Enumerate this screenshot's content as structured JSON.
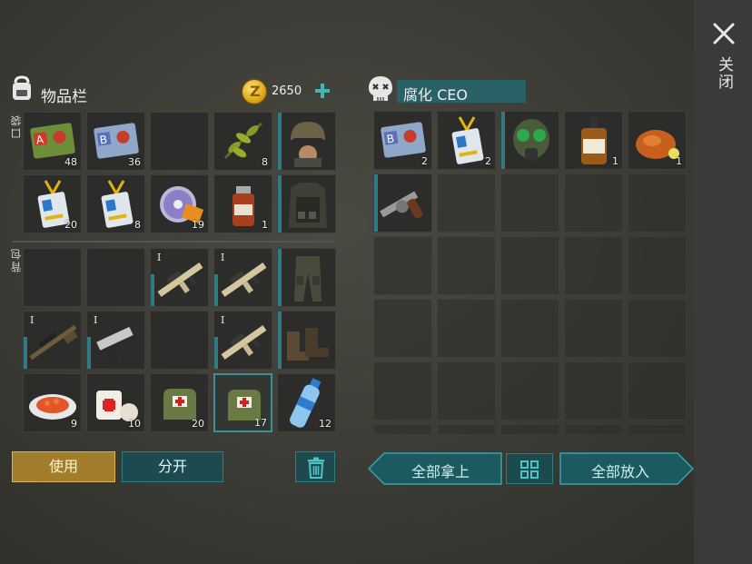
{
  "close": {
    "label": "关闭"
  },
  "inventory": {
    "title": "物品栏",
    "money": "2650",
    "pocket_label": "口袋",
    "backpack_label": "背包",
    "pocket_slots": [
      {
        "item": "keycard-a-icon",
        "count": "48"
      },
      {
        "item": "keycard-b-icon",
        "count": "36"
      },
      {
        "item": "empty-slot",
        "count": ""
      },
      {
        "item": "herb-plant-icon",
        "count": "8"
      },
      {
        "item": "helmet-icon",
        "count": "",
        "equip": true
      },
      {
        "item": "id-badge-icon",
        "count": "20"
      },
      {
        "item": "id-badge-icon",
        "count": "8"
      },
      {
        "item": "cd-disc-icon",
        "count": "19"
      },
      {
        "item": "medicine-bottle-icon",
        "count": "1"
      },
      {
        "item": "body-armor-icon",
        "count": "",
        "equip": true
      }
    ],
    "backpack_slots": [
      {
        "item": "empty-slot",
        "count": ""
      },
      {
        "item": "empty-slot",
        "count": ""
      },
      {
        "item": "assault-rifle-icon",
        "count": "",
        "tier": "I"
      },
      {
        "item": "assault-rifle-icon",
        "count": "",
        "tier": "I"
      },
      {
        "item": "tactical-pants-icon",
        "count": "",
        "equip": true
      },
      {
        "item": "sniper-rifle-icon",
        "count": "",
        "tier": "I"
      },
      {
        "item": "desert-eagle-pistol-icon",
        "count": "",
        "tier": "I"
      },
      {
        "item": "empty-slot",
        "count": ""
      },
      {
        "item": "assault-rifle-icon",
        "count": "",
        "tier": "I"
      },
      {
        "item": "boots-icon",
        "count": "",
        "equip": true
      },
      {
        "item": "food-plate-icon",
        "count": "9"
      },
      {
        "item": "bandage-icon",
        "count": "10"
      },
      {
        "item": "medkit-bag-icon",
        "count": "20"
      },
      {
        "item": "medkit-bag-icon",
        "count": "17",
        "selected": true
      },
      {
        "item": "water-bottle-icon",
        "count": "12"
      }
    ],
    "buttons": {
      "use": "使用",
      "split": "分开"
    }
  },
  "loot": {
    "name": "腐化 CEO",
    "slots": [
      {
        "item": "keycard-b-icon",
        "count": "2"
      },
      {
        "item": "id-badge-icon",
        "count": "2"
      },
      {
        "item": "gas-mask-icon",
        "count": ""
      },
      {
        "item": "whiskey-bottle-icon",
        "count": "1"
      },
      {
        "item": "roast-chicken-icon",
        "count": "1"
      },
      {
        "item": "revolver-icon",
        "count": ""
      }
    ],
    "buttons": {
      "take_all": "全部拿上",
      "put_all": "全部放入"
    }
  },
  "colors": {
    "accent": "#2f7a84",
    "use_button": "#a27e2c",
    "gold": "#d9a414"
  }
}
